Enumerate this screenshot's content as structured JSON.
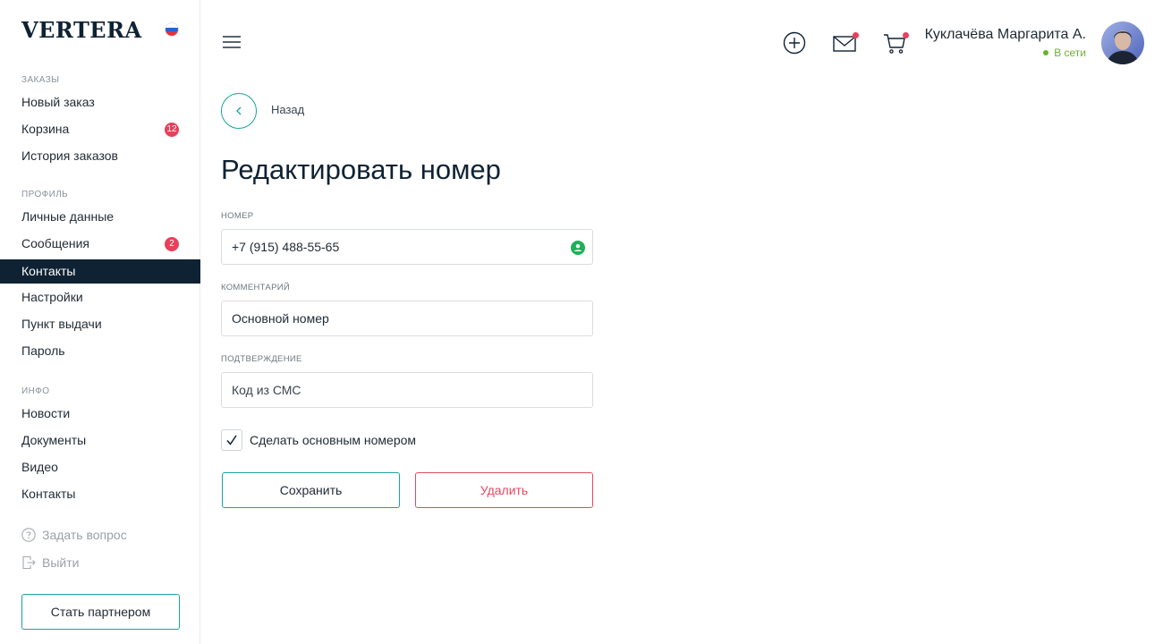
{
  "brand": {
    "logo": "VERTERA",
    "flag_icon": "russia-flag-icon"
  },
  "sidebar": {
    "sections": [
      {
        "title": "ЗАКАЗЫ"
      },
      {
        "title": "ПРОФИЛЬ"
      },
      {
        "title": "ИНФО"
      }
    ],
    "items": [
      {
        "label": "Новый заказ"
      },
      {
        "label": "Корзина",
        "badge": "12"
      },
      {
        "label": "История заказов"
      },
      {
        "label": "Личные данные"
      },
      {
        "label": "Сообщения",
        "badge": "2"
      },
      {
        "label": "Контакты",
        "active": true
      },
      {
        "label": "Настройки"
      },
      {
        "label": "Пункт выдачи"
      },
      {
        "label": "Пароль"
      },
      {
        "label": "Новости"
      },
      {
        "label": "Документы"
      },
      {
        "label": "Видео"
      },
      {
        "label": "Контакты"
      }
    ],
    "ask_question": "Задать вопрос",
    "logout": "Выйти",
    "partner_button": "Стать партнером"
  },
  "header": {
    "icons": [
      "menu-icon",
      "add-icon",
      "mail-icon",
      "cart-icon"
    ],
    "user_name": "Куклачёва Маргарита А.",
    "status": "В сети"
  },
  "main": {
    "back_label": "Назад",
    "title": "Редактировать номер",
    "fields": {
      "phone": {
        "label": "НОМЕР",
        "value": "+7 (915) 488-55-65"
      },
      "comment": {
        "label": "КОММЕНТАРИЙ",
        "value": "Основной номер"
      },
      "confirm": {
        "label": "ПОДТВЕРЖДЕНИЕ",
        "placeholder": "Код из СМС"
      }
    },
    "make_primary": {
      "label": "Сделать основным номером",
      "checked": true
    },
    "save_label": "Сохранить",
    "delete_label": "Удалить"
  },
  "colors": {
    "accent": "#1aa39a",
    "danger": "#e04a62",
    "badge": "#e8405b",
    "online": "#6cb02e",
    "dark": "#0e2233"
  }
}
